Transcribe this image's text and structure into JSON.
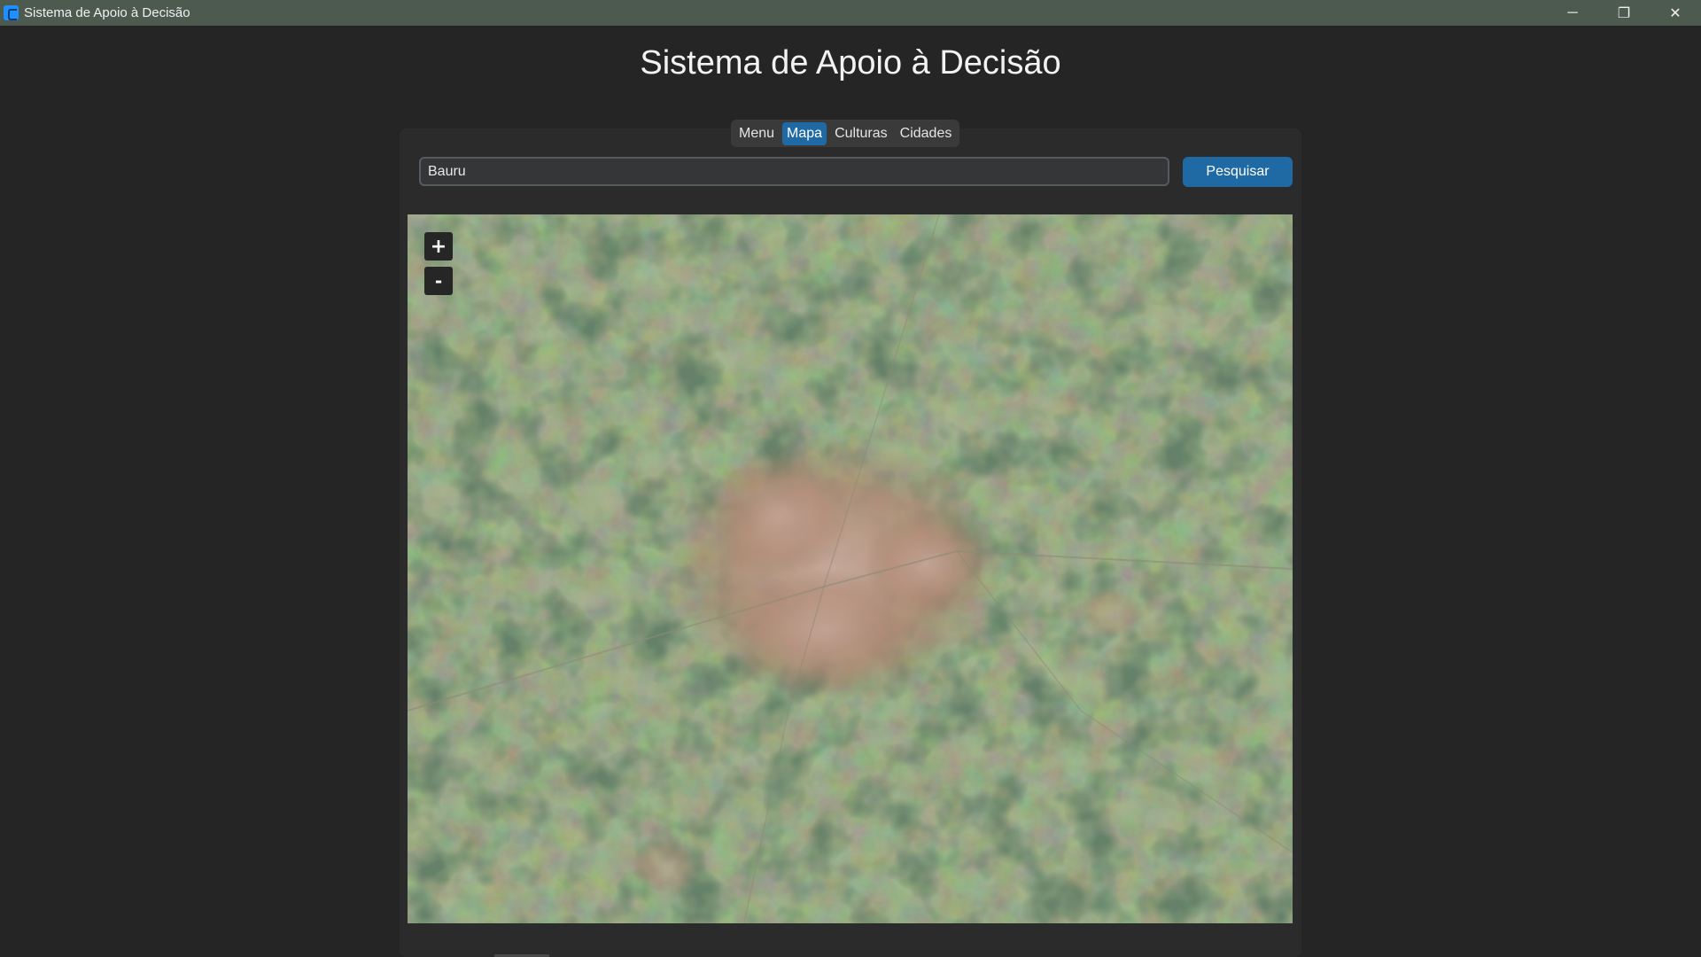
{
  "window": {
    "title": "Sistema de Apoio à Decisão",
    "controls": {
      "minimize": "─",
      "maximize": "❐",
      "close": "✕"
    }
  },
  "header": {
    "title": "Sistema de Apoio à Decisão"
  },
  "tabs": [
    {
      "label": "Menu",
      "active": false
    },
    {
      "label": "Mapa",
      "active": true
    },
    {
      "label": "Culturas",
      "active": false
    },
    {
      "label": "Cidades",
      "active": false
    }
  ],
  "search": {
    "value": "Bauru",
    "button_label": "Pesquisar"
  },
  "map": {
    "zoom_in_label": "+",
    "zoom_out_label": "-",
    "view": "satellite",
    "colors": {
      "forest": "#2f4a2c",
      "field": "#6b7550",
      "urban": "#b88f7e",
      "soil": "#8a7a55"
    }
  },
  "colors": {
    "accent": "#1f6aa5",
    "background": "#252525",
    "panel": "#2b2b2b",
    "titlebar": "#4d5a50"
  }
}
